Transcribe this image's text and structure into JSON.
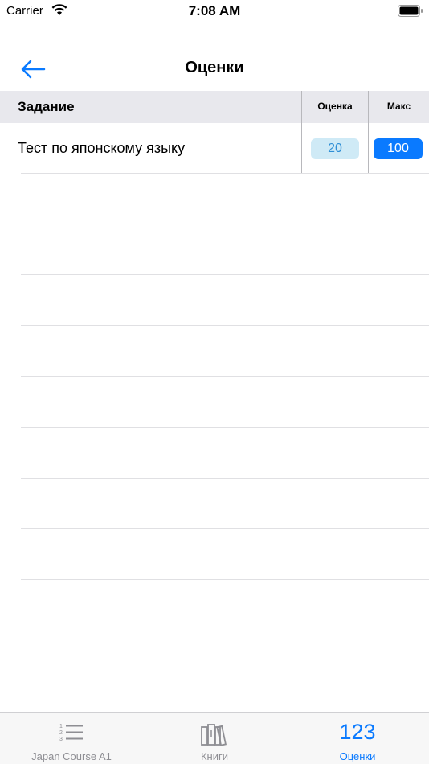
{
  "status_bar": {
    "carrier": "Carrier",
    "time": "7:08 AM"
  },
  "nav": {
    "title": "Оценки"
  },
  "table": {
    "headers": {
      "task": "Задание",
      "score": "Оценка",
      "max": "Макс"
    },
    "rows": [
      {
        "task": "Тест по японскому языку",
        "score": "20",
        "max": "100"
      }
    ]
  },
  "tab_bar": {
    "tabs": [
      {
        "label": "Japan Course A1",
        "icon": "numbered-list-icon",
        "active": false
      },
      {
        "label": "Книги",
        "icon": "books-icon",
        "active": false
      },
      {
        "label": "Оценки",
        "icon_text": "123",
        "active": true
      }
    ]
  },
  "colors": {
    "accent": "#0a7aff",
    "score_badge_bg": "#cfeaf6",
    "header_bg": "#e8e8ed"
  }
}
